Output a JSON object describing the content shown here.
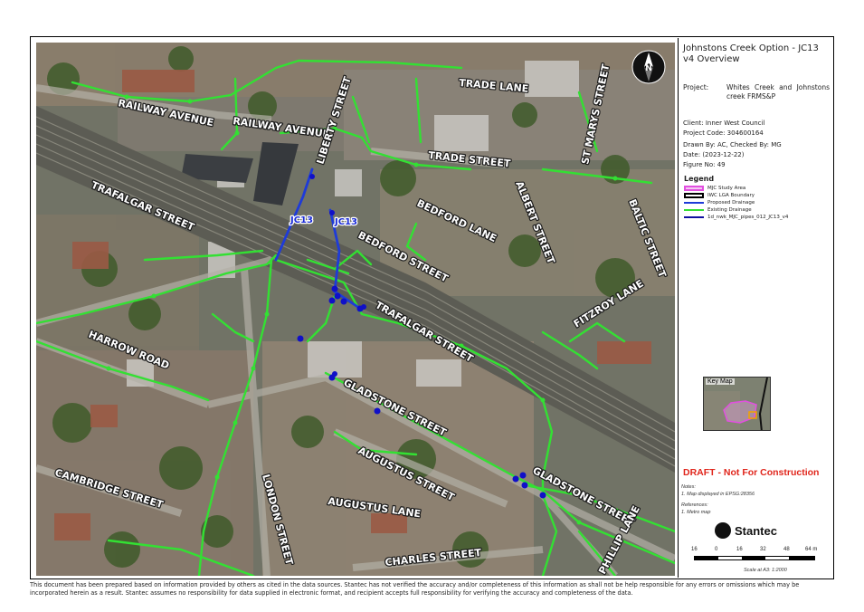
{
  "panel": {
    "title": "Johnstons Creek Option - JC13 v4 Overview",
    "project_label": "Project:",
    "project_value": "Whites Creek and Johnstons creek FRMS&P",
    "client": "Client: Inner West Council",
    "project_code": "Project Code: 304600164",
    "drawn_by": "Drawn By: AC, Checked By: MG",
    "date": "Date: (2023-12-22)",
    "figure_no": "Figure No: 49"
  },
  "legend": {
    "title": "Legend",
    "items": [
      {
        "label": "MJC Study Area",
        "color": "#e24fe0",
        "style": "outline"
      },
      {
        "label": "IWC LGA Boundary",
        "color": "#000000",
        "style": "outline"
      },
      {
        "label": "Proposed Drainage",
        "color": "#1e3bd8",
        "style": "line"
      },
      {
        "label": "Existing Drainage",
        "color": "#33e033",
        "style": "line"
      },
      {
        "label": "1d_nwk_MJC_pipes_012_JC13_v4",
        "color": "#1010a0",
        "style": "line"
      }
    ]
  },
  "keymap": {
    "label": "Key Map"
  },
  "draft": "DRAFT - Not For Construction",
  "notes": {
    "title": "Notes:",
    "text": "1. Map displayed in EPSG:28356",
    "ref_title": "References:",
    "ref_text": "1. Metro map"
  },
  "logo": {
    "word": "Stantec"
  },
  "scale": {
    "ticks": [
      "16",
      "0",
      "16",
      "32",
      "48",
      "64 m"
    ],
    "text": "Scale at A3: 1:2000"
  },
  "north": {
    "label": "N"
  },
  "map": {
    "streets": [
      "RAILWAY AVENUE",
      "RAILWAY AVENUE",
      "LIBERTY STREET",
      "TRADE LANE",
      "TRADE STREET",
      "ST MARYS STREET",
      "TRAFALGAR STREET",
      "BEDFORD LANE",
      "BEDFORD STREET",
      "ALBERT STREET",
      "BALTIC STREET",
      "TRAFALGAR STREET",
      "FITZROY LANE",
      "HARROW ROAD",
      "GLADSTONE STREET",
      "AUGUSTUS STREET",
      "AUGUSTUS LANE",
      "CAMBRIDGE STREET",
      "LONDON STREET",
      "GLADSTONE STREET",
      "PHILLIP LANE",
      "CHARLES STREET"
    ],
    "pipe_labels": [
      "JC13",
      "JC13"
    ]
  },
  "disclaimer": "This document has been prepared based on information provided by others as cited in the data sources. Stantec has not verified the accuracy and/or completeness of this information as shall not be help responsible for any errors or omissions which may be incorporated herein as a result. Stantec assumes no responsibility for data supplied in electronic format, and recipient accepts full responsibility for verifying the accuracy and completeness of the data.",
  "colors": {
    "existing_drainage": "#33e033",
    "proposed_drainage": "#1e3bd8",
    "draft_red": "#e0251b"
  }
}
